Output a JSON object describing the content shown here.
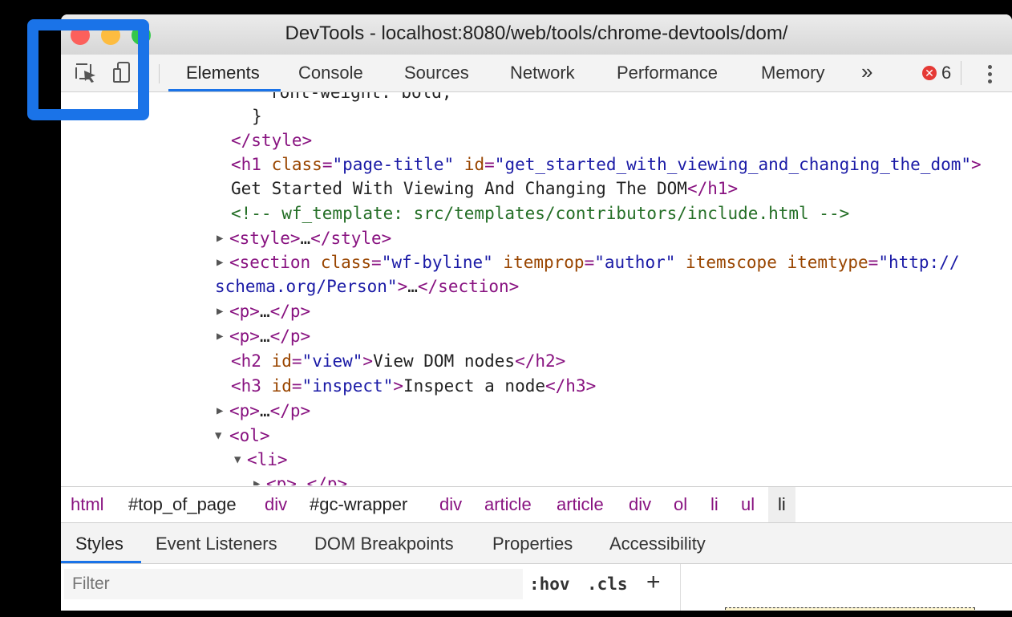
{
  "window": {
    "title": "DevTools - localhost:8080/web/tools/chrome-devtools/dom/"
  },
  "toolbar": {
    "tabs": [
      "Elements",
      "Console",
      "Sources",
      "Network",
      "Performance",
      "Memory"
    ],
    "more_label": "»",
    "error_count": "6"
  },
  "dom": {
    "line0": "font-weight: bold;",
    "line1": "}",
    "line2_tag": "</style>",
    "h1_open": "<h1",
    "h1_class_attr": "class",
    "h1_class_val": "\"page-title\"",
    "h1_id_attr": "id",
    "h1_id_val": "\"get_started_with_viewing_and_changing_the_dom\"",
    "h1_close_bracket": ">",
    "h1_text": "Get Started With Viewing And Changing The DOM",
    "h1_close": "</h1>",
    "comment": "<!-- wf_template: src/templates/contributors/include.html -->",
    "style_collapsed_open": "<style>",
    "ellipsis": "…",
    "style_collapsed_close": "</style>",
    "section_open": "<section",
    "section_class_attr": "class",
    "section_class_val": "\"wf-byline\"",
    "section_itemprop_attr": "itemprop",
    "section_itemprop_val": "\"author\"",
    "section_itemscope_attr": "itemscope",
    "section_itemtype_attr": "itemtype",
    "section_itemtype_val1": "\"http://",
    "section_itemtype_val2": "schema.org/Person\"",
    "section_close": "</section>",
    "p_open": "<p>",
    "p_close": "</p>",
    "h2_open": "<h2",
    "h2_id_attr": "id",
    "h2_id_val": "\"view\"",
    "h2_text": "View DOM nodes",
    "h2_close": "</h2>",
    "h3_open": "<h3",
    "h3_id_attr": "id",
    "h3_id_val": "\"inspect\"",
    "h3_text": "Inspect a node",
    "h3_close": "</h3>",
    "ol_open": "<ol>",
    "li_open": "<li>",
    "p_partial": "<p>…</p>"
  },
  "breadcrumbs": [
    "html",
    "#top_of_page",
    "div",
    "#gc-wrapper",
    "div",
    "article",
    "article",
    "div",
    "ol",
    "li",
    "ul",
    "li"
  ],
  "subtabs": [
    "Styles",
    "Event Listeners",
    "DOM Breakpoints",
    "Properties",
    "Accessibility"
  ],
  "filterbar": {
    "placeholder": "Filter",
    "hov": ":hov",
    "cls": ".cls",
    "plus": "+"
  },
  "colors": {
    "accent": "#1a73e8",
    "tag": "#881280",
    "attr_name": "#994500",
    "attr_value": "#1a1aa6",
    "comment": "#236e25",
    "error": "#e53935"
  }
}
